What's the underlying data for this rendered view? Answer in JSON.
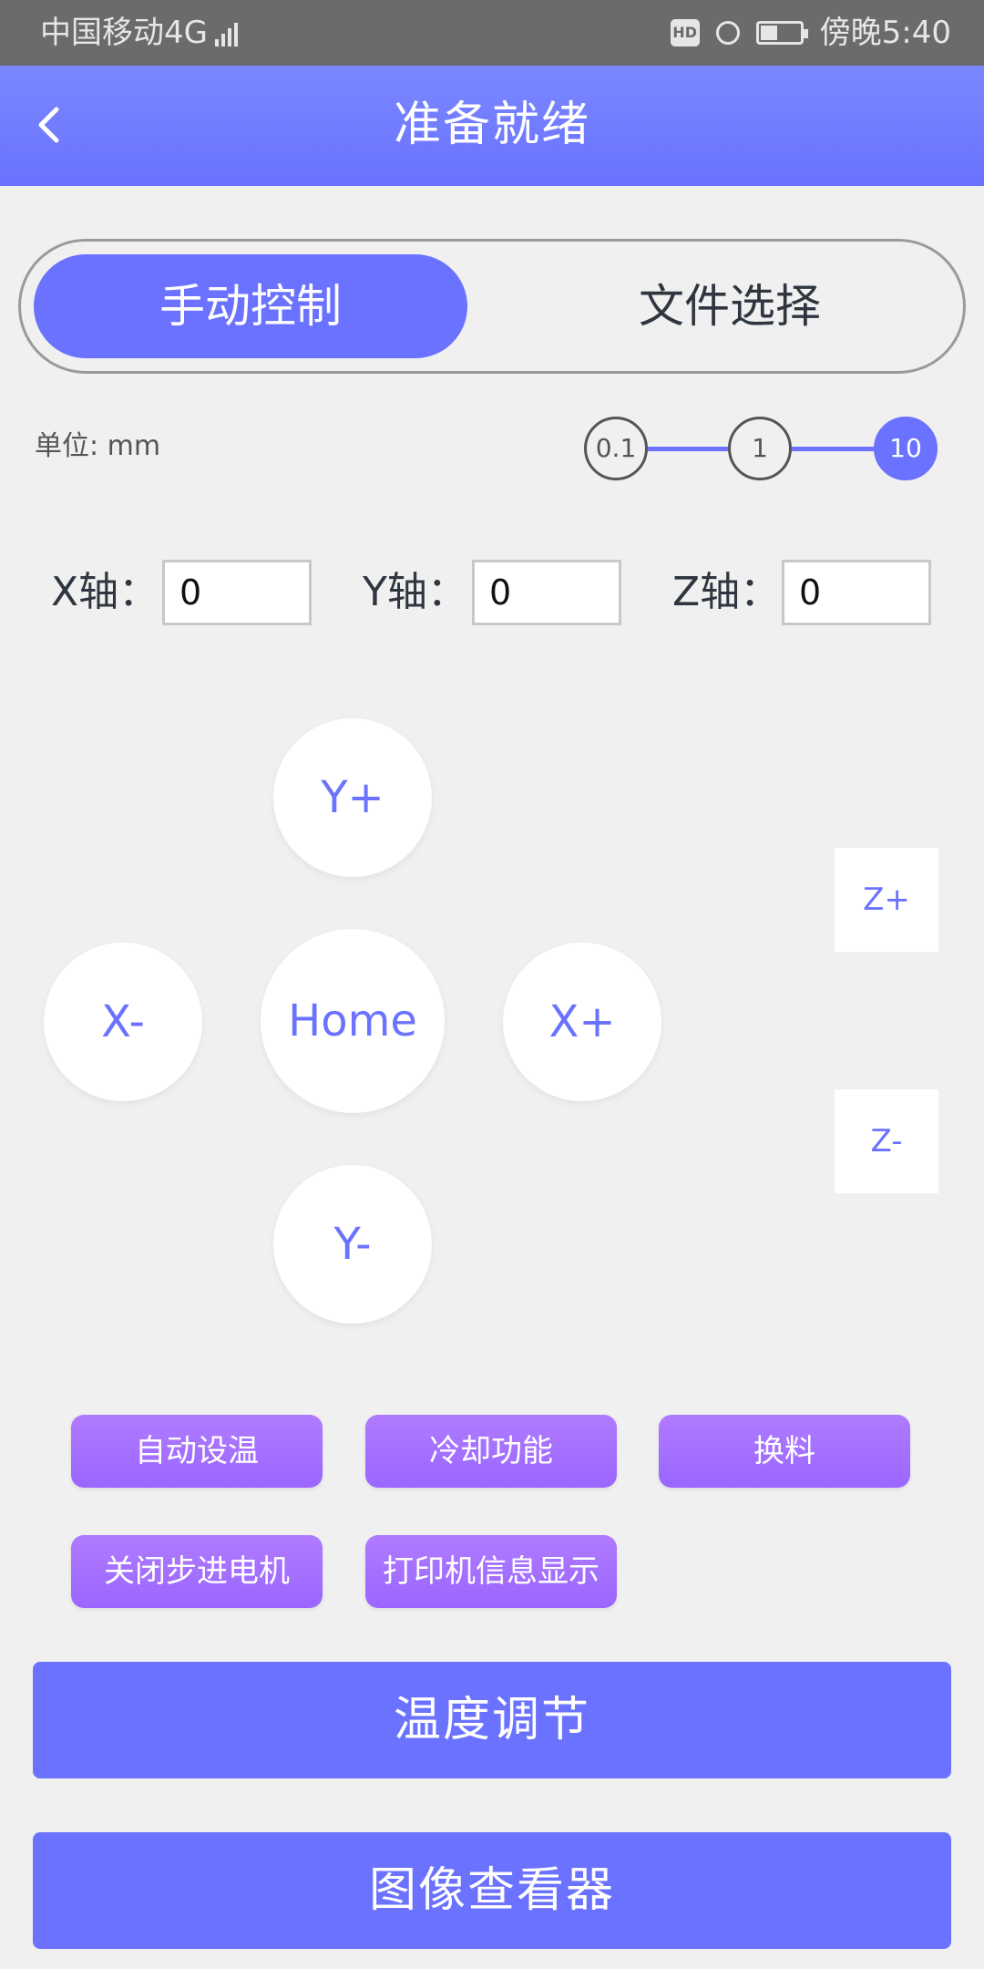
{
  "status_bar": {
    "carrier": "中国移动4G",
    "network_type": "4G",
    "time_text": "傍晚5:40",
    "hd_label": "HD",
    "battery_level": 0.4
  },
  "header": {
    "title": "准备就绪"
  },
  "segment": {
    "manual_label": "手动控制",
    "file_label": "文件选择",
    "active": "manual"
  },
  "units": {
    "label": "单位: mm",
    "steps": [
      "0.1",
      "1",
      "10"
    ],
    "selected": "10"
  },
  "axes": {
    "x_label": "X轴：",
    "y_label": "Y轴：",
    "z_label": "Z轴：",
    "x_value": "0",
    "y_value": "0",
    "z_value": "0"
  },
  "jog": {
    "y_plus": "Y+",
    "y_minus": "Y-",
    "x_minus": "X-",
    "x_plus": "X+",
    "home": "Home",
    "z_plus": "Z+",
    "z_minus": "Z-"
  },
  "functions": {
    "auto_temp": "自动设温",
    "cooling": "冷却功能",
    "filament_change": "换料",
    "disable_steppers": "关闭步进电机",
    "printer_info": "打印机信息显示"
  },
  "actions": {
    "temperature_adjust": "温度调节",
    "image_viewer": "图像查看器"
  },
  "colors": {
    "accent": "#6a72ff",
    "header_top": "#7a88ff",
    "function_button": "#9a66ff",
    "status_bar": "#6b6b6b",
    "background": "#f0f0f0"
  }
}
